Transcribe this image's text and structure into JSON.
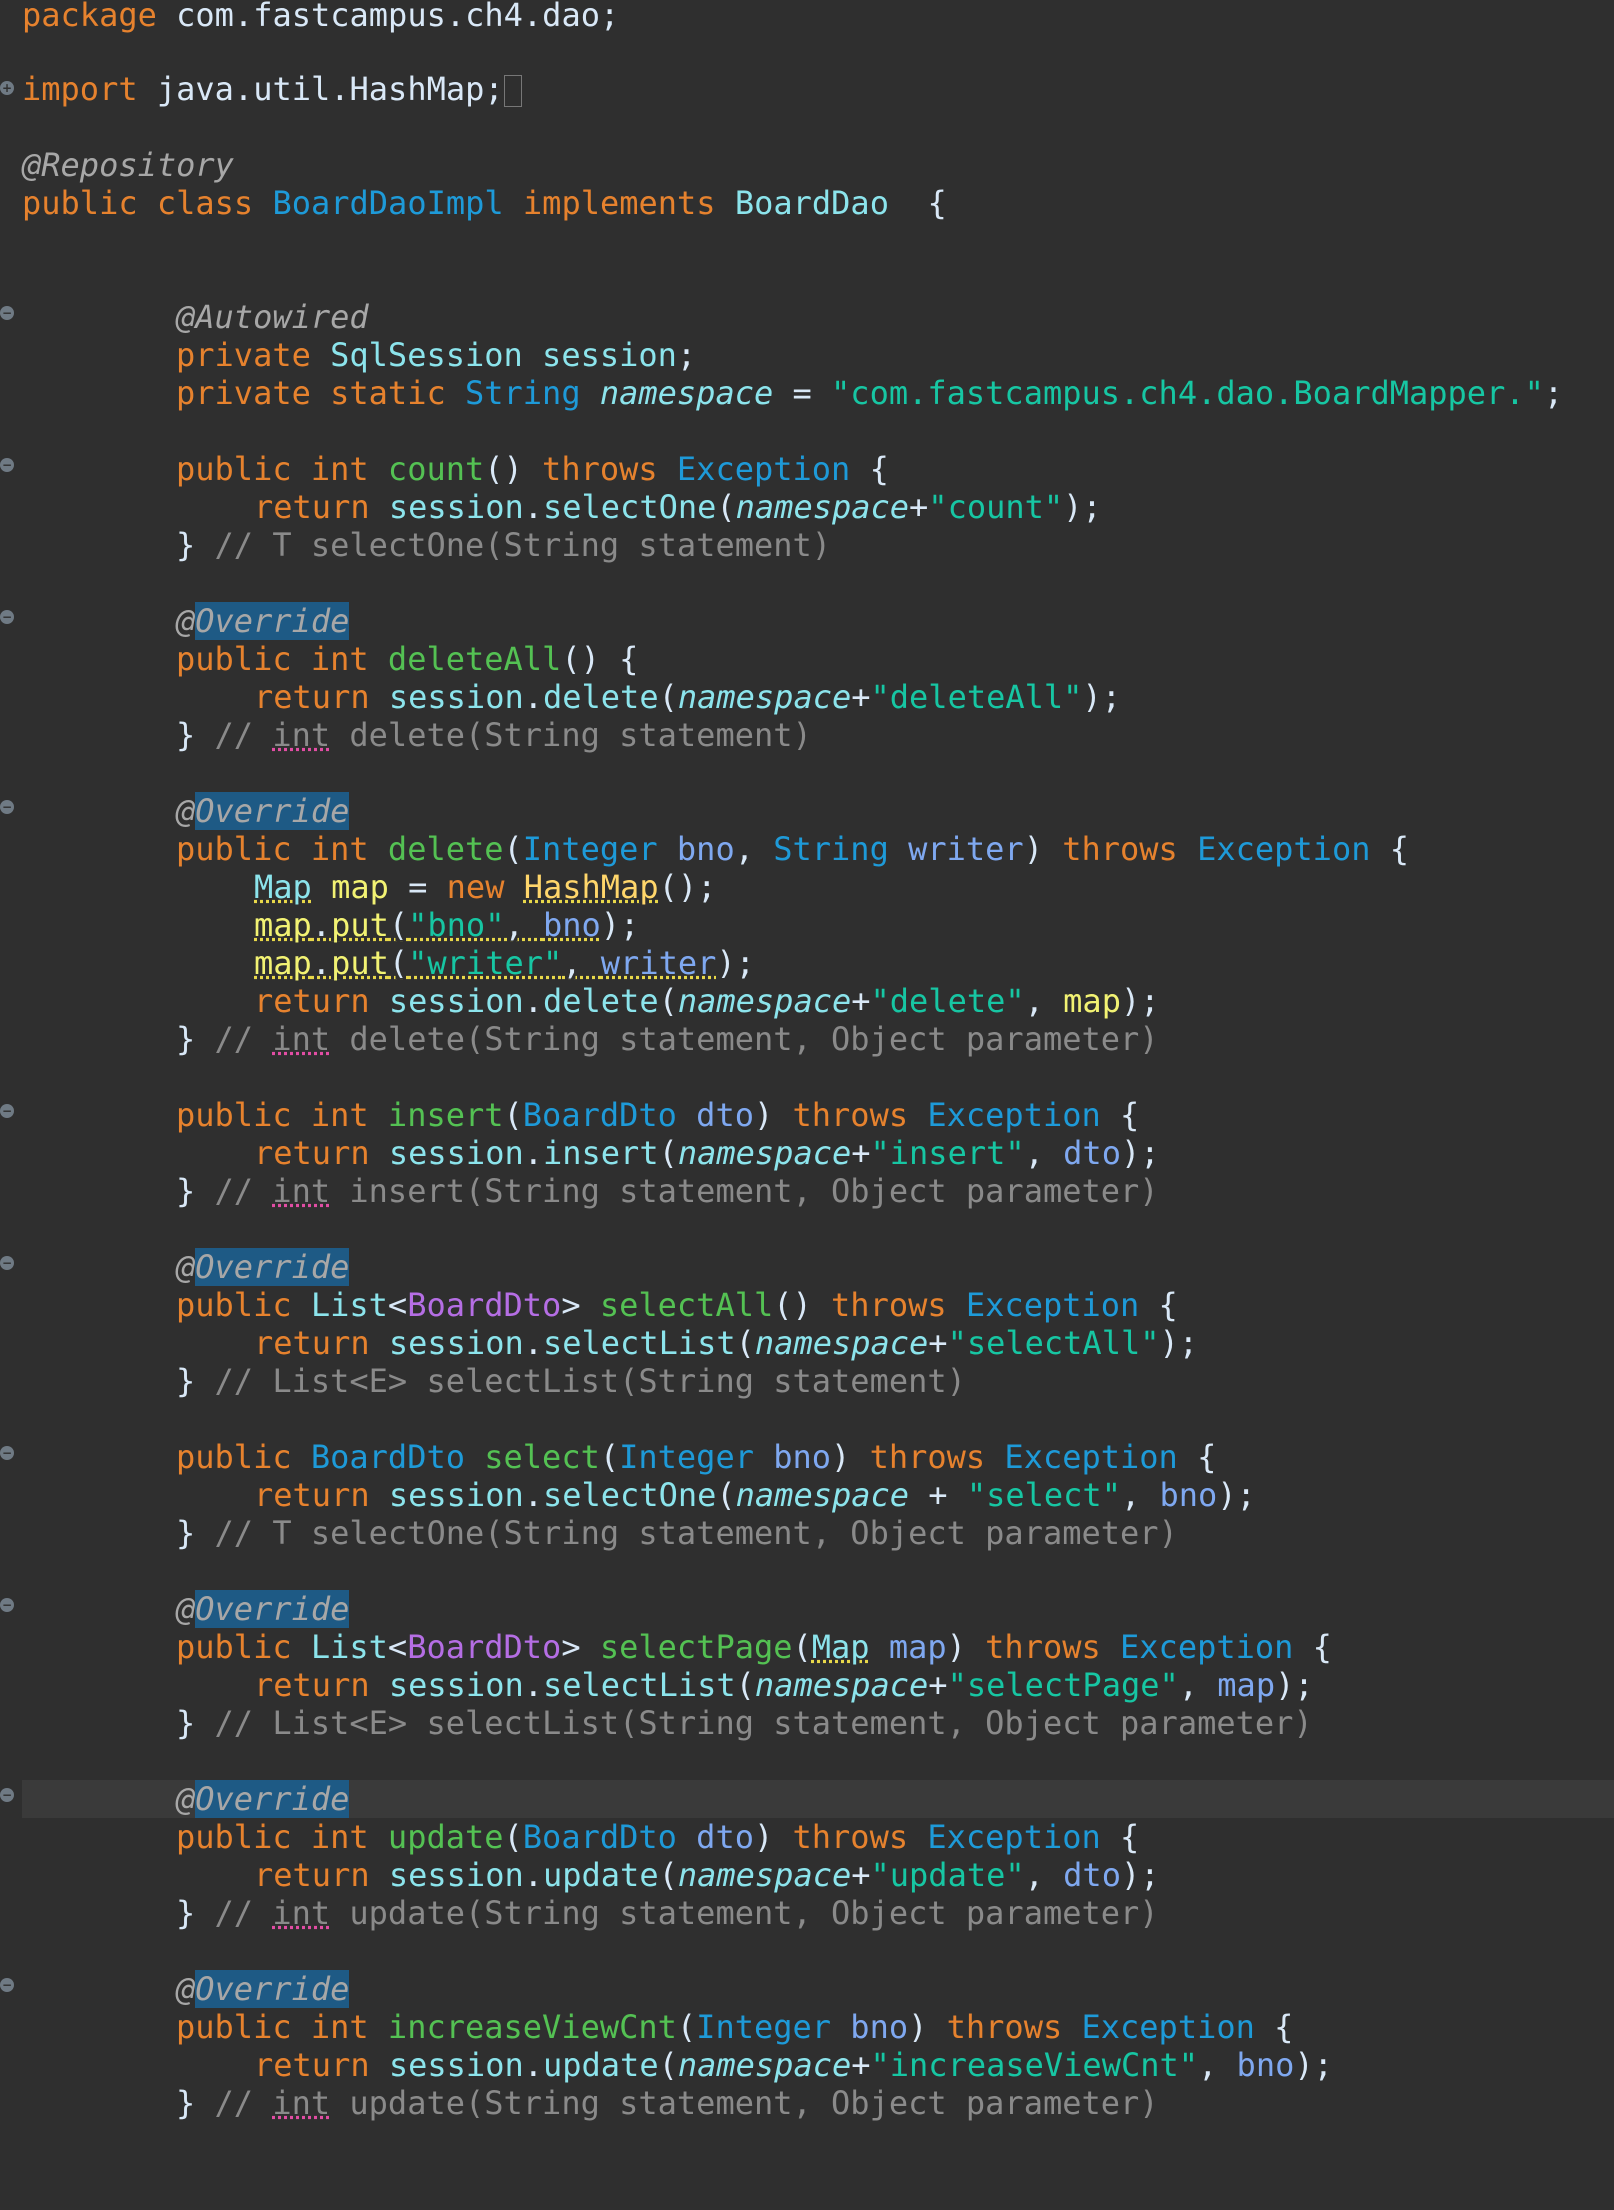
{
  "editor": {
    "file": {
      "package_kw": "package",
      "package_name": "com.fastcampus.ch4.dao",
      "import_kw": "import",
      "import_name": "java.util.HashMap",
      "repository_annotation": "@Repository",
      "class_decl": {
        "public": "public",
        "class": "class",
        "name": "BoardDaoImpl",
        "implements": "implements",
        "interface": "BoardDao"
      }
    },
    "fields": {
      "autowired": "@Autowired",
      "session_line": {
        "private": "private",
        "type": "SqlSession",
        "name": "session"
      },
      "namespace_line": {
        "private": "private",
        "static": "static",
        "type": "String",
        "name": "namespace",
        "value": "\"com.fastcampus.ch4.dao.BoardMapper.\""
      }
    },
    "override": "Override",
    "override_at": "@",
    "methods": {
      "count": {
        "name": "count",
        "ret_type": "int",
        "exception": "Exception",
        "call": "selectOne",
        "arg": "\"count\"",
        "comment": "// T selectOne(String statement)"
      },
      "deleteAll": {
        "name": "deleteAll",
        "call": "delete",
        "arg": "\"deleteAll\"",
        "comment_pre": "// ",
        "comment_int": "int",
        "comment_post": " delete(String statement)"
      },
      "delete": {
        "name": "delete",
        "p1_type": "Integer",
        "p1": "bno",
        "p2_type": "String",
        "p2": "writer",
        "map_type": "Map",
        "map_var": "map",
        "new_kw": "new",
        "hashmap": "HashMap",
        "put": "put",
        "put1_key": "\"bno\"",
        "put2_key": "\"writer\"",
        "call": "delete",
        "arg": "\"delete\"",
        "comment_int": "int",
        "comment_post": " delete(String statement, Object parameter)"
      },
      "insert": {
        "name": "insert",
        "p_type": "BoardDto",
        "p": "dto",
        "call": "insert",
        "arg": "\"insert\"",
        "comment_int": "int",
        "comment_post": " insert(String statement, Object parameter)"
      },
      "selectAll": {
        "name": "selectAll",
        "ret_list": "List",
        "ret_generic": "BoardDto",
        "call": "selectList",
        "arg": "\"selectAll\"",
        "comment": "// List<E> selectList(String statement)"
      },
      "select": {
        "name": "select",
        "ret_type": "BoardDto",
        "p_type": "Integer",
        "p": "bno",
        "call": "selectOne",
        "arg": "\"select\"",
        "comment": "// T selectOne(String statement, Object parameter)"
      },
      "selectPage": {
        "name": "selectPage",
        "p_type": "Map",
        "p": "map",
        "call": "selectList",
        "arg": "\"selectPage\"",
        "comment": "// List<E> selectList(String statement, Object parameter)"
      },
      "update": {
        "name": "update",
        "p_type": "BoardDto",
        "p": "dto",
        "call": "update",
        "arg": "\"update\"",
        "comment_int": "int",
        "comment_post": " update(String statement, Object parameter)"
      },
      "increaseViewCnt": {
        "name": "increaseViewCnt",
        "p_type": "Integer",
        "p": "bno",
        "call": "update",
        "arg": "\"increaseViewCnt\"",
        "comment_int": "int",
        "comment_post": " update(String statement, Object parameter)"
      }
    },
    "keywords": {
      "public": "public",
      "int": "int",
      "throws": "throws",
      "return": "return",
      "session": "session",
      "namespace": "namespace"
    }
  }
}
